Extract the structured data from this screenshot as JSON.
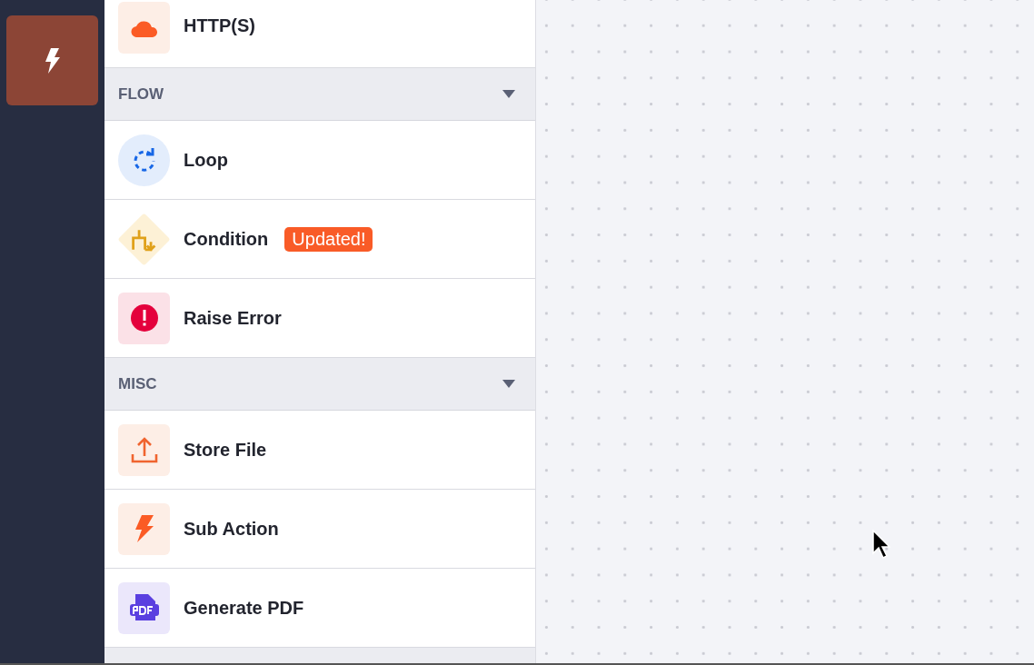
{
  "sections": [
    {
      "items": [
        {
          "label": "HTTP(S)",
          "kind": "cloud"
        }
      ]
    },
    {
      "title": "FLOW",
      "expanded": true,
      "items": [
        {
          "label": "Loop",
          "kind": "loop"
        },
        {
          "label": "Condition",
          "kind": "condition",
          "badge": "Updated!"
        },
        {
          "label": "Raise Error",
          "kind": "error"
        }
      ]
    },
    {
      "title": "MISC",
      "expanded": true,
      "items": [
        {
          "label": "Store File",
          "kind": "upload"
        },
        {
          "label": "Sub Action",
          "kind": "bolt"
        },
        {
          "label": "Generate PDF",
          "kind": "pdf"
        }
      ]
    }
  ]
}
